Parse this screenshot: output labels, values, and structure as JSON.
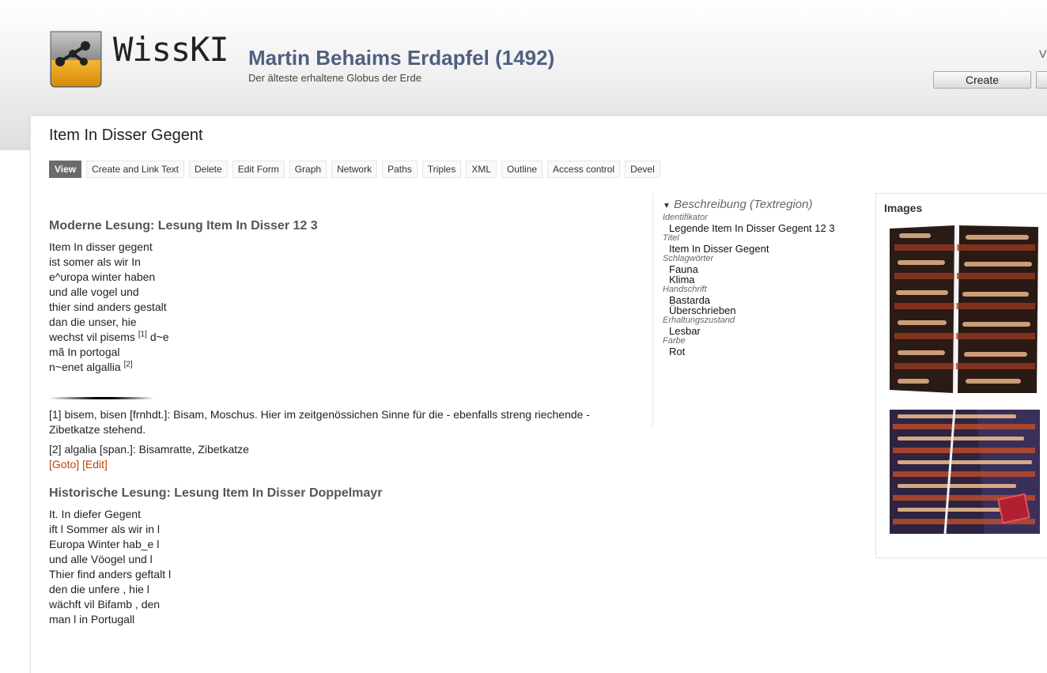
{
  "header": {
    "logo_text": "WissKI",
    "site_name": "Martin Behaims Erdapfel (1492)",
    "site_slogan": "Der älteste erhaltene Globus der Erde",
    "right_letter": "V",
    "create_label": "Create"
  },
  "page": {
    "title": "Item In Disser Gegent",
    "tabs": [
      "View",
      "Create and Link Text",
      "Delete",
      "Edit Form",
      "Graph",
      "Network",
      "Paths",
      "Triples",
      "XML",
      "Outline",
      "Access control",
      "Devel"
    ]
  },
  "modern": {
    "heading": "Moderne Lesung: Lesung Item In Disser 12 3",
    "lines": [
      "Item In disser gegent",
      "ist somer als wir In",
      "e^uropa winter haben",
      "und alle vogel und",
      "thier sind anders gestalt",
      "dan die unser, hie",
      "wechst vil pisems",
      "mã In portogal",
      "n~enet algallia"
    ],
    "line7_tail": "d~e",
    "fn_marker_1": "[1]",
    "fn_marker_2": "[2]",
    "footnotes": [
      "[1] bisem, bisen [frnhdt.]: Bisam, Moschus. Hier im zeitgenössichen Sinne für die - ebenfalls streng riechende - Zibetkatze stehend.",
      "[2] algalia [span.]: Bisamratte, Zibetkatze"
    ],
    "goto_label": "[Goto]",
    "edit_label": "[Edit]"
  },
  "historic": {
    "heading": "Historische Lesung: Lesung Item In Disser Doppelmayr",
    "lines": [
      "It. In diefer Gegent",
      "ift l Sommer als wir in l",
      "Europa Winter hab_e l",
      "und alle Vöogel und l",
      "Thier find anders geftalt l",
      "den die unfere , hie l",
      "wächft vil Bifamb , den",
      "man l in Portugall"
    ]
  },
  "sidebar": {
    "heading": "Beschreibung (Textregion)",
    "fields": [
      {
        "label": "Identifikator",
        "values": [
          "Legende Item In Disser Gegent 12 3"
        ]
      },
      {
        "label": "Titel",
        "values": [
          "Item In Disser Gegent"
        ]
      },
      {
        "label": "Schlagwörter",
        "values": [
          "Fauna",
          "Klima"
        ]
      },
      {
        "label": "Handschrift",
        "values": [
          "Bastarda",
          "Überschrieben"
        ]
      },
      {
        "label": "Erhaltungszustand",
        "values": [
          "Lesbar"
        ]
      },
      {
        "label": "Farbe",
        "values": [
          "Rot"
        ]
      }
    ]
  },
  "images": {
    "title": "Images"
  }
}
